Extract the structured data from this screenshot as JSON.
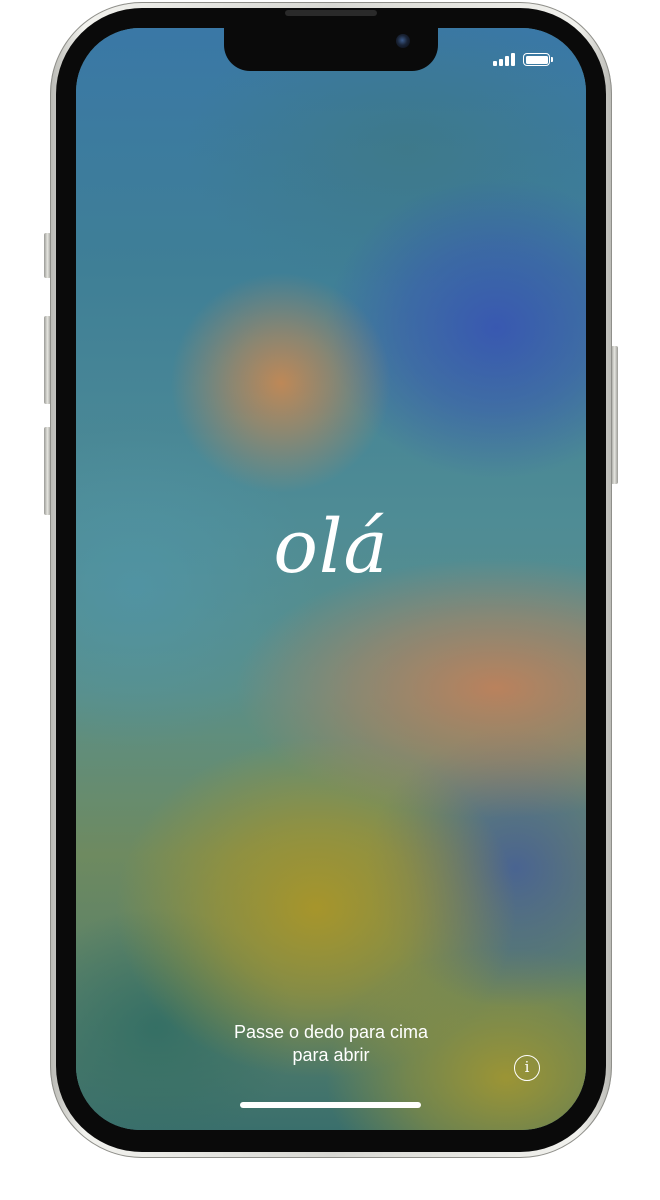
{
  "device": {
    "model": "iPhone",
    "frame_color": "#e6e6e1"
  },
  "status_bar": {
    "signal_icon": "cellular-signal-icon",
    "signal_bars": 4,
    "battery_icon": "battery-icon",
    "battery_level": 1.0
  },
  "lock_screen": {
    "greeting": "olá",
    "swipe_hint_line1": "Passe o dedo para cima",
    "swipe_hint_line2": "para abrir",
    "info_icon": "info-icon",
    "info_glyph": "i"
  },
  "colors": {
    "text": "#ffffff",
    "wallpaper_blue": "#3a78a6",
    "wallpaper_orange": "#c48854",
    "wallpaper_indigo": "#3856b2",
    "wallpaper_olive": "#aa9628"
  }
}
